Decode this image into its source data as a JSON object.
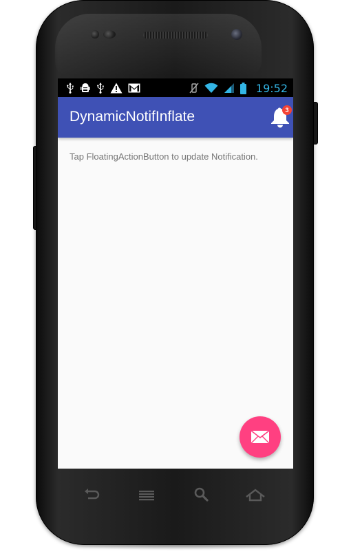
{
  "status_bar": {
    "time": "19:52",
    "left_icons": [
      "usb-icon",
      "android-debug-icon",
      "usb-icon",
      "warning-icon",
      "gmail-icon"
    ],
    "right_icons": [
      "vibrate-mute-icon",
      "wifi-icon",
      "signal-icon",
      "battery-icon"
    ],
    "clock_color": "#33b5e5"
  },
  "app_bar": {
    "title": "DynamicNotifInflate",
    "color": "#3f51b5",
    "notification_count": "3"
  },
  "content": {
    "message": "Tap FloatingActionButton to update Notification."
  },
  "fab": {
    "icon": "mail-icon",
    "color": "#ff4081"
  },
  "device_nav": {
    "keys": [
      "back-icon",
      "menu-icon",
      "search-icon",
      "home-icon"
    ]
  }
}
